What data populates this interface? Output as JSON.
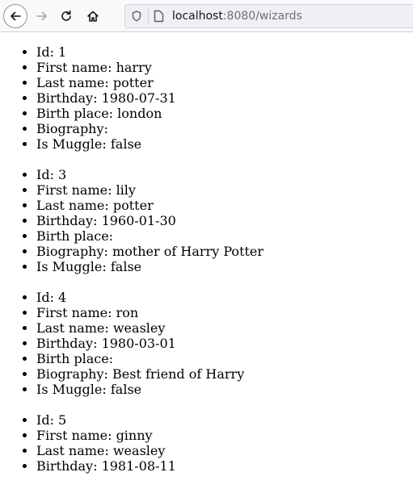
{
  "browser": {
    "url_host": "localhost",
    "url_path": ":8080/wizards",
    "icons": {
      "back": "back-arrow-icon",
      "forward": "forward-arrow-icon",
      "reload": "reload-icon",
      "home": "home-icon",
      "shield": "shield-icon",
      "page": "page-icon"
    }
  },
  "labels": {
    "id": "Id:",
    "first_name": "First name:",
    "last_name": "Last name:",
    "birthday": "Birthday:",
    "birth_place": "Birth place:",
    "biography": "Biography:",
    "is_muggle": "Is Muggle:"
  },
  "wizards": [
    {
      "id": "1",
      "first_name": "harry",
      "last_name": "potter",
      "birthday": "1980-07-31",
      "birth_place": "london",
      "biography": "",
      "is_muggle": "false"
    },
    {
      "id": "3",
      "first_name": "lily",
      "last_name": "potter",
      "birthday": "1960-01-30",
      "birth_place": "",
      "biography": "mother of Harry Potter",
      "is_muggle": "false"
    },
    {
      "id": "4",
      "first_name": "ron",
      "last_name": "weasley",
      "birthday": "1980-03-01",
      "birth_place": "",
      "biography": "Best friend of Harry",
      "is_muggle": "false"
    },
    {
      "id": "5",
      "first_name": "ginny",
      "last_name": "weasley",
      "birthday": "1981-08-11"
    }
  ]
}
